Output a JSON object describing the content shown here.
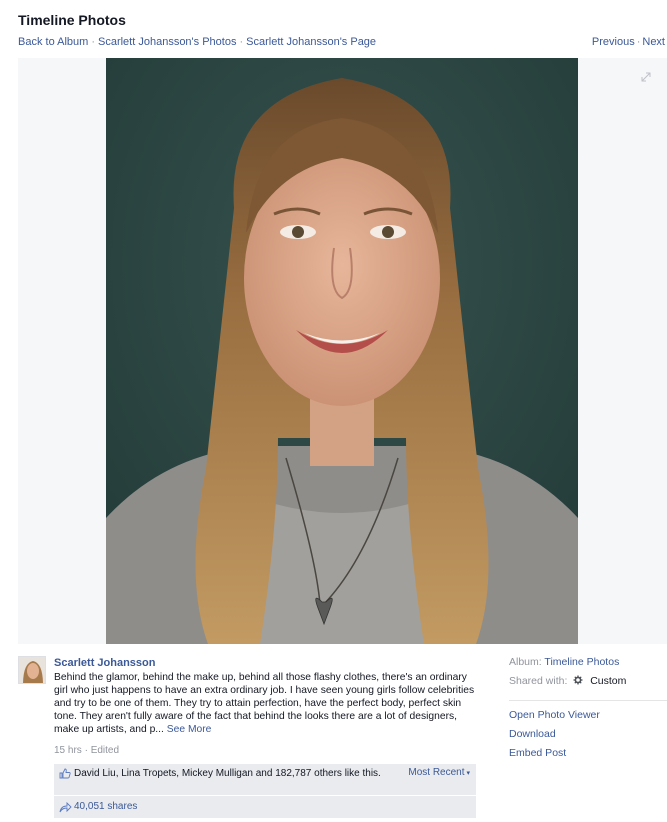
{
  "page": {
    "title": "Timeline Photos"
  },
  "breadcrumbs": [
    "Back to Album",
    "Scarlett Johansson's Photos",
    "Scarlett Johansson's Page"
  ],
  "pager": {
    "previous": "Previous",
    "next": "Next"
  },
  "post": {
    "author": "Scarlett Johansson",
    "caption": "Behind the glamor, behind the make up, behind all those flashy clothes, there's an ordinary girl who just happens to have an extra ordinary job. I have seen young girls follow celebrities and try to be one of them. They try to attain perfection, have the perfect body, perfect skin tone. They aren't fully aware of the fact that behind the looks there are a lot of designers, make up artists, and p...",
    "see_more": "See More",
    "time": "15 hrs",
    "edited": "Edited"
  },
  "ufi": {
    "likes": "David Liu, Lina Tropets, Mickey Mulligan and 182,787 others like this.",
    "sort": "Most Recent",
    "shares": "40,051 shares"
  },
  "side": {
    "album_label": "Album:",
    "album_value": "Timeline Photos",
    "shared_label": "Shared with:",
    "shared_value": "Custom",
    "actions": [
      "Open Photo Viewer",
      "Download",
      "Embed Post"
    ]
  },
  "colors": {
    "link": "#3b5998",
    "muted": "#90949c",
    "ufi_bg": "#e9ebee",
    "photo_bg": "#2f4a47"
  },
  "icons": [
    "expand-icon",
    "like-icon",
    "share-icon",
    "gear-icon"
  ]
}
